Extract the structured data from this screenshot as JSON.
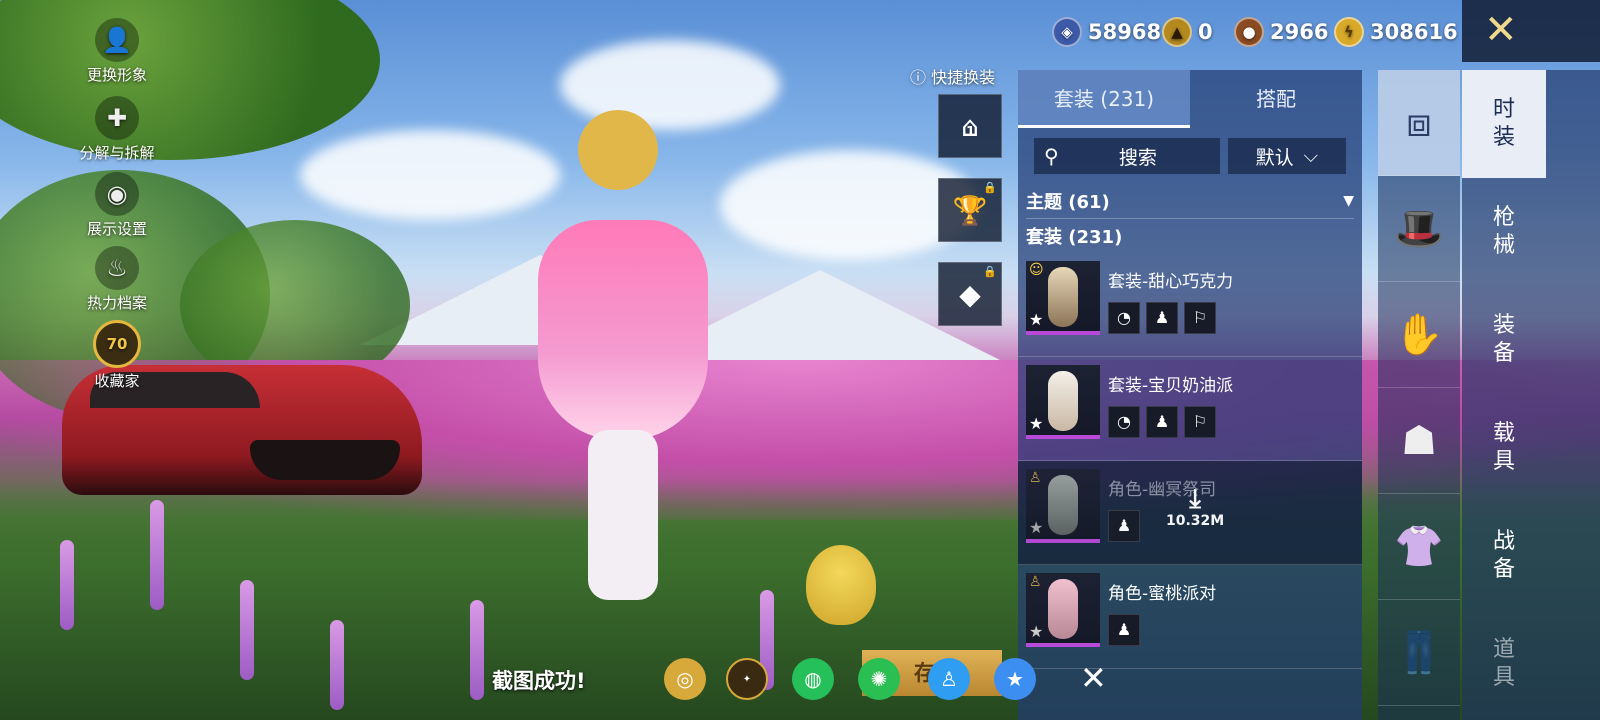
{
  "colors": {
    "accent": "#b949d8",
    "gold": "#e4b73e",
    "panel": "#233c73"
  },
  "left_menu": [
    {
      "label": "更换形象",
      "icon": "person-icon"
    },
    {
      "label": "分解与拆解",
      "icon": "puzzle-icon"
    },
    {
      "label": "展示设置",
      "icon": "eye-icon"
    },
    {
      "label": "热力档案",
      "icon": "flame-icon"
    },
    {
      "label": "收藏家",
      "icon": "collector-badge-icon",
      "badge": "70"
    }
  ],
  "currencies": [
    {
      "icon": "blue-coin-icon",
      "value": "58968"
    },
    {
      "icon": "medal-coin-icon",
      "value": "0"
    },
    {
      "icon": "bronze-coin-icon",
      "value": "2966"
    },
    {
      "icon": "gold-coin-icon",
      "value": "308616"
    }
  ],
  "quick_outfit": {
    "label": "快捷换装",
    "slot1_number": "1"
  },
  "panel": {
    "tabs": [
      {
        "label": "套装 (231)",
        "active": true
      },
      {
        "label": "搭配",
        "active": false
      }
    ],
    "search_placeholder": "搜索",
    "sort_label": "默认",
    "section_theme": "主题 (61)",
    "section_suits": "套装 (231)",
    "items": [
      {
        "name": "套装-甜心巧克力",
        "minis": 3,
        "dim": false
      },
      {
        "name": "套装-宝贝奶油派",
        "minis": 3,
        "dim": false
      },
      {
        "name": "角色-幽冥祭司",
        "minis": 1,
        "dim": true,
        "download_size": "10.32M"
      },
      {
        "name": "角色-蜜桃派对",
        "minis": 1,
        "dim": false
      }
    ]
  },
  "right_tabs": [
    {
      "label": "时装",
      "active": true
    },
    {
      "label": "枪械"
    },
    {
      "label": "装备"
    },
    {
      "label": "载具"
    },
    {
      "label": "战备"
    },
    {
      "label": "道具",
      "dim": true
    }
  ],
  "bottom": {
    "toast": "截图成功!",
    "save_label": "存搭",
    "share_icons": [
      "game-circle-icon",
      "peace-elite-icon",
      "wechat-icon",
      "moments-icon",
      "qq-icon",
      "qzone-icon"
    ]
  }
}
